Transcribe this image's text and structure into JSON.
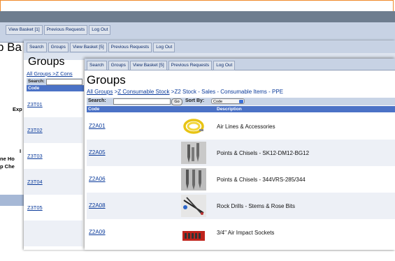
{
  "back_window": {
    "nav": [
      "View Basket [1]",
      "Previous Requests",
      "Log Out"
    ],
    "title_fragment": "p Ba",
    "side_texts": [
      "Exp",
      "I",
      "ne Ho",
      "p Che"
    ]
  },
  "mid_window": {
    "nav": [
      "Search",
      "Groups",
      "View Basket [5]",
      "Previous Requests",
      "Log Out"
    ],
    "title": "Groups",
    "breadcrumb": "All Groups >Z Cons",
    "search_label": "Search:",
    "code_header": "Code",
    "rows": [
      "Z3T01",
      "Z3T02",
      "Z3T03",
      "Z3T04",
      "Z3T05"
    ]
  },
  "front_window": {
    "nav": [
      "Search",
      "Groups",
      "View Basket [5]",
      "Previous Requests",
      "Log Out"
    ],
    "title": "Groups",
    "breadcrumb": {
      "parts": [
        "All Groups",
        ">",
        "Z Consumable Stock",
        ">",
        "Z2 Stock - Sales - Consumable Items - PPE"
      ]
    },
    "search_label": "Search:",
    "go_label": "Go",
    "sort_label": "Sort By:",
    "sort_value": "Code",
    "columns": [
      "Code",
      "Description"
    ],
    "rows": [
      {
        "code": "Z2A01",
        "description": "Air Lines & Accessories",
        "thumb": "air-hose-icon"
      },
      {
        "code": "Z2A05",
        "description": "Points & Chisels - SK12-DM12-BG12",
        "thumb": "chisel-icon"
      },
      {
        "code": "Z2A06",
        "description": "Points & Chisels - 344VRS-285/344",
        "thumb": "chisel-icon"
      },
      {
        "code": "Z2A08",
        "description": "Rock Drills - Stems & Rose Bits",
        "thumb": "drill-bits-icon"
      },
      {
        "code": "Z2A09",
        "description": "3/4\" Air Impact Sockets",
        "thumb": "socket-set-icon"
      }
    ]
  }
}
